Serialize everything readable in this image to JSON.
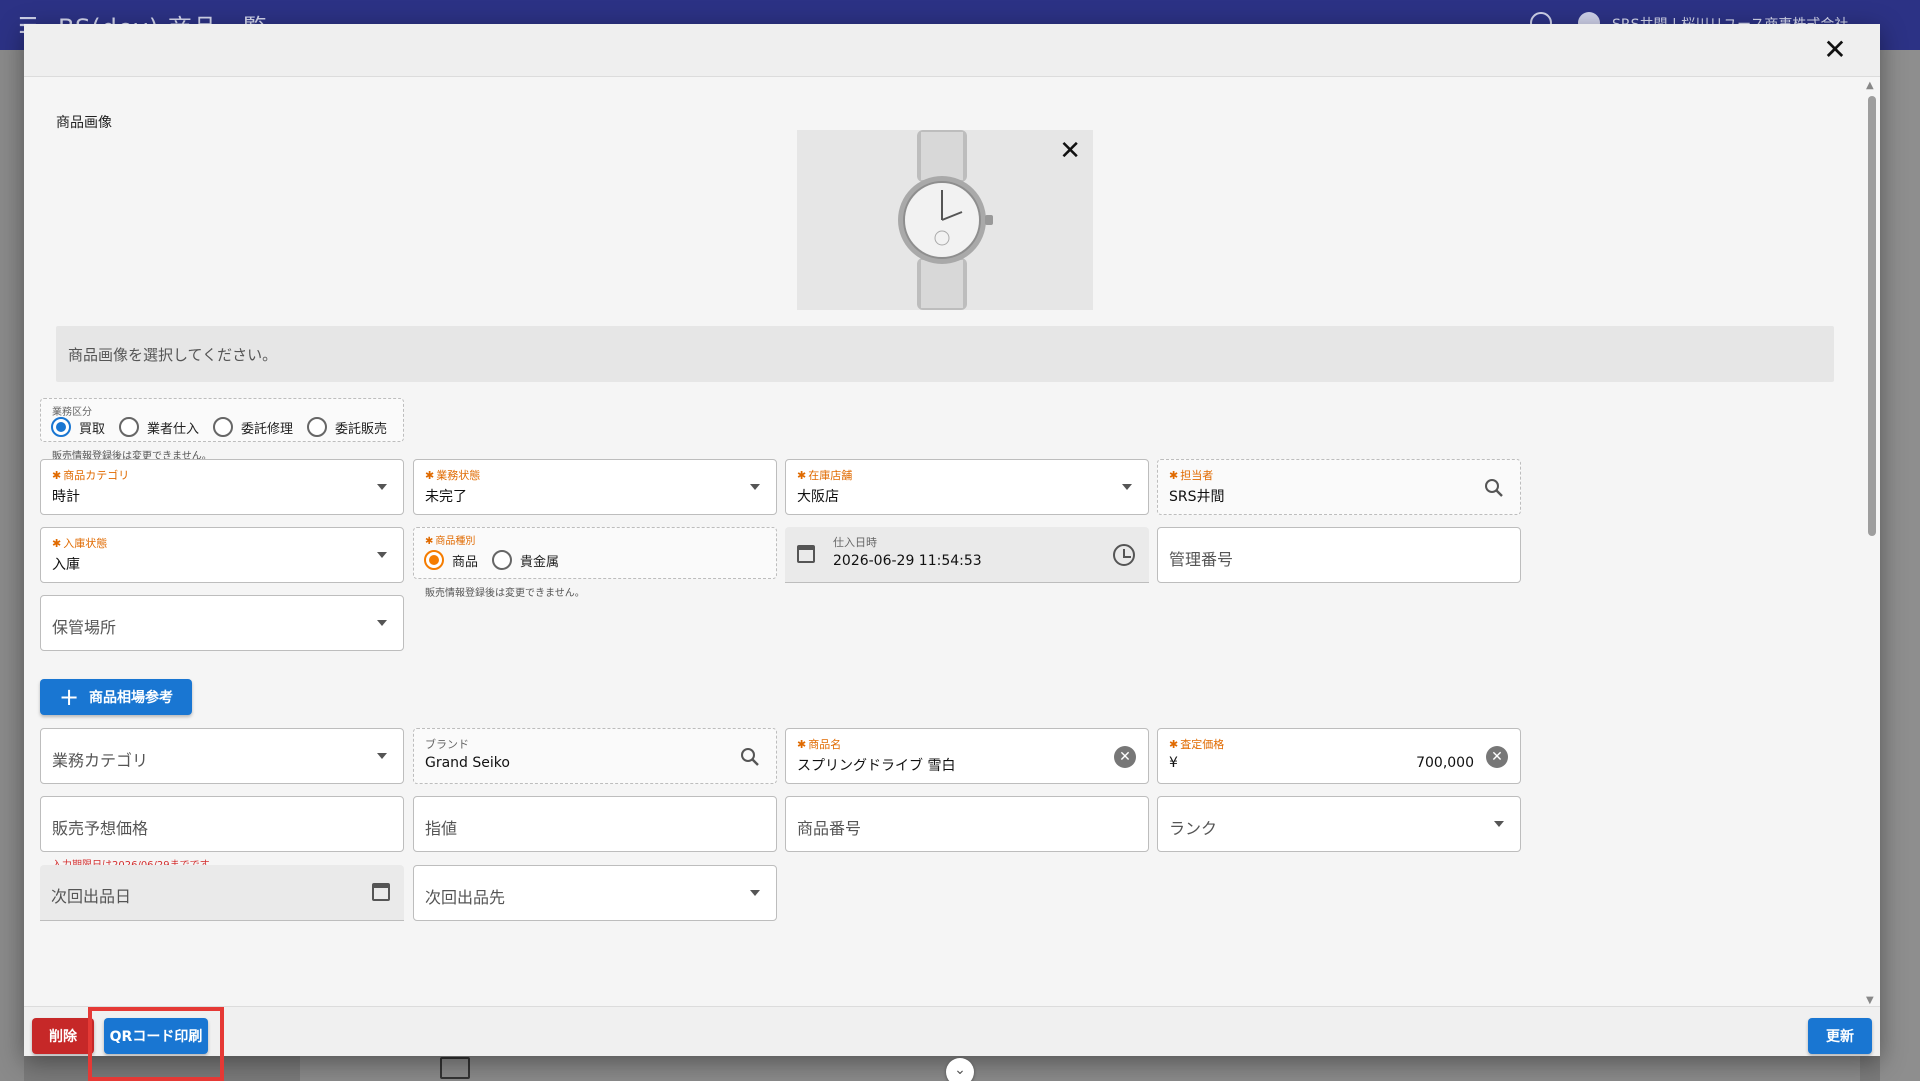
{
  "app": {
    "title": "BS(dev) 商品一覧",
    "user": "SRS井間 | 桜川リユース商事株式会社"
  },
  "dialog": {
    "image_section_label": "商品画像",
    "dropzone_text": "商品画像を選択してください。",
    "business_type": {
      "label": "業務区分",
      "options": [
        "買取",
        "業者仕入",
        "委託修理",
        "委託販売"
      ],
      "selected": "買取",
      "helper": "販売情報登録後は変更できません。"
    },
    "product_category": {
      "label": "商品カテゴリ",
      "value": "時計"
    },
    "business_status": {
      "label": "業務状態",
      "value": "未完了"
    },
    "store": {
      "label": "在庫店舗",
      "value": "大阪店"
    },
    "staff": {
      "label": "担当者",
      "value": "SRS井間"
    },
    "inbound_status": {
      "label": "入庫状態",
      "value": "入庫"
    },
    "product_type": {
      "label": "商品種別",
      "options": [
        "商品",
        "貴金属"
      ],
      "selected": "商品",
      "helper": "販売情報登録後は変更できません。"
    },
    "purchase_datetime": {
      "label": "仕入日時",
      "value": "2026-06-29 11:54:53"
    },
    "management_number": {
      "placeholder": "管理番号"
    },
    "storage_location": {
      "placeholder": "保管場所"
    },
    "market_ref_button": "商品相場参考",
    "business_category": {
      "placeholder": "業務カテゴリ"
    },
    "brand": {
      "label": "ブランド",
      "value": "Grand Seiko"
    },
    "product_name": {
      "label": "商品名",
      "value": "スプリングドライブ 雪白"
    },
    "appraisal_price": {
      "label": "査定価格",
      "currency": "¥",
      "value": "700,000"
    },
    "expected_sale_price": {
      "placeholder": "販売予想価格",
      "helper": "入力期限日は2026/06/29までです。"
    },
    "limit_price": {
      "placeholder": "指値"
    },
    "product_number": {
      "placeholder": "商品番号"
    },
    "rank": {
      "placeholder": "ランク"
    },
    "next_listing_date": {
      "placeholder": "次回出品日"
    },
    "next_listing_destination": {
      "placeholder": "次回出品先"
    }
  },
  "footer": {
    "delete_label": "削除",
    "qr_label": "QRコード印刷",
    "update_label": "更新"
  },
  "colors": {
    "primary": "#1976d2",
    "danger": "#c62828",
    "required": "#e06a00",
    "appbar": "#2c3285",
    "highlight": "#e53935"
  }
}
